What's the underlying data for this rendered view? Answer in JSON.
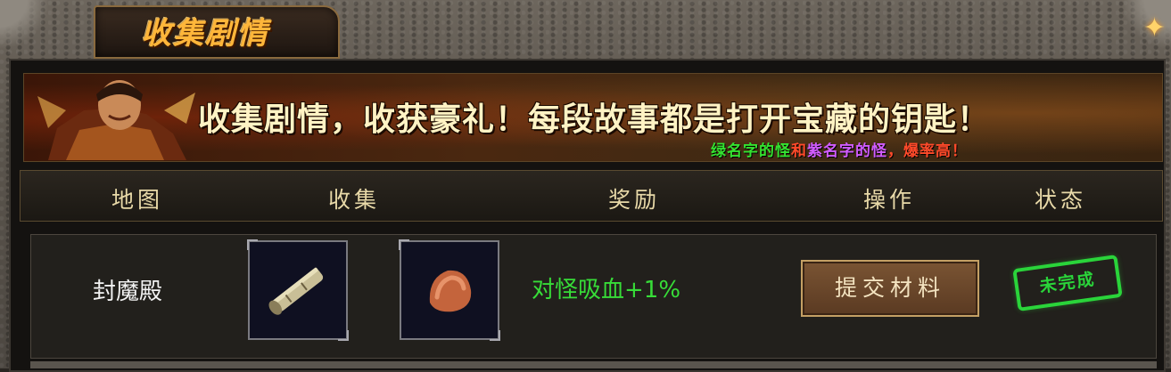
{
  "panel": {
    "title": "收集剧情"
  },
  "banner": {
    "headline": "收集剧情，收获豪礼！每段故事都是打开宝藏的钥匙！",
    "sub_part1": "绿名字的怪",
    "sub_part2": "和",
    "sub_part3": "紫名字的怪",
    "sub_part4": "，爆率高！"
  },
  "table": {
    "headers": {
      "map": "地图",
      "collect": "收集",
      "reward": "奖励",
      "action": "操作",
      "status": "状态"
    },
    "rows": [
      {
        "map": "封魔殿",
        "items": [
          "scroll-item-icon",
          "meat-item-icon"
        ],
        "reward": "对怪吸血+1%",
        "action_label": "提交材料",
        "status": "未完成"
      }
    ]
  },
  "colors": {
    "title_gold": "#ffb63a",
    "reward_green": "#37dc38",
    "status_green": "#2ad43a",
    "sub_red": "#ff4a2a",
    "sub_purple": "#d15cff"
  }
}
